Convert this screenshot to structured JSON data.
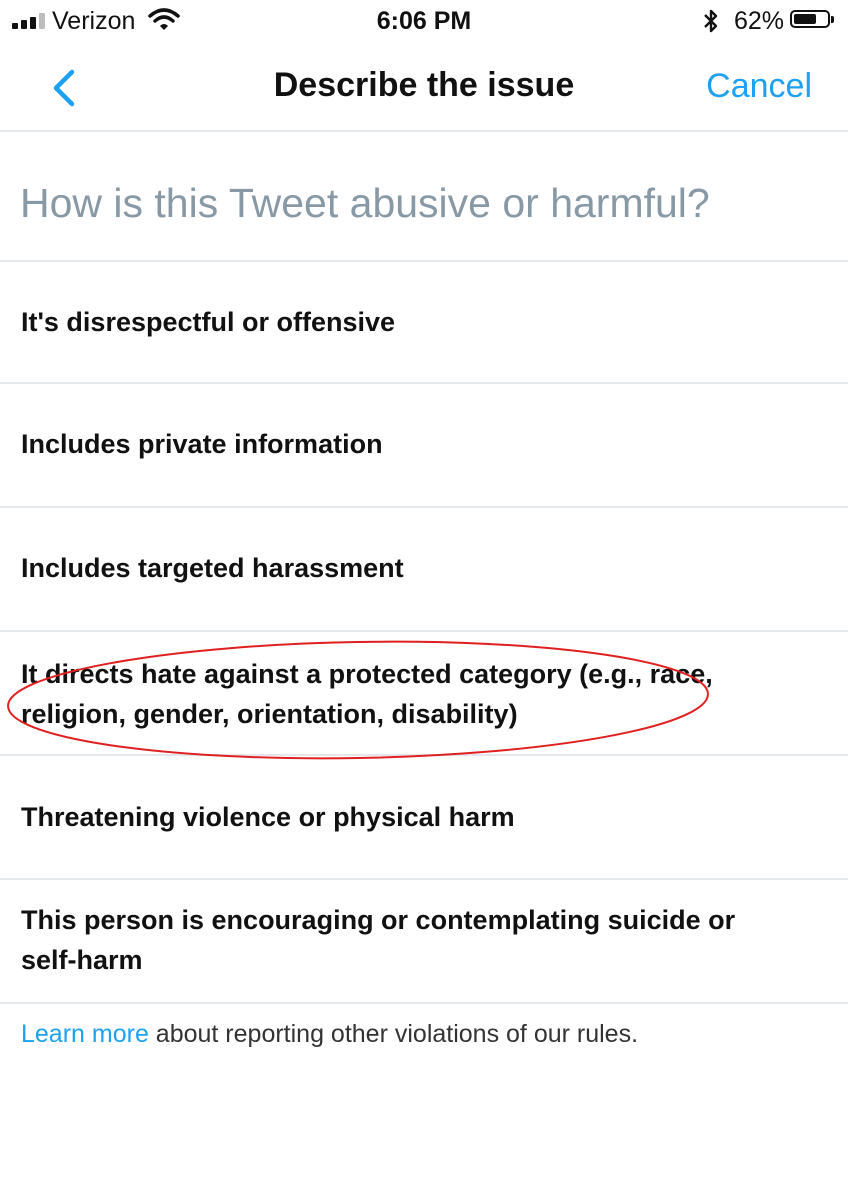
{
  "status_bar": {
    "carrier": "Verizon",
    "time": "6:06 PM",
    "battery_percent": "62%",
    "signal_icon": "signal-bars-icon",
    "wifi_icon": "wifi-icon",
    "bluetooth_icon": "bluetooth-icon",
    "battery_icon": "battery-icon"
  },
  "nav": {
    "title": "Describe the issue",
    "cancel_label": "Cancel",
    "back_icon": "chevron-left-icon"
  },
  "question": {
    "text": "How is this Tweet abusive or harmful?"
  },
  "options": [
    {
      "label": "It's disrespectful or offensive"
    },
    {
      "label": "Includes private information"
    },
    {
      "label": "Includes targeted harassment"
    },
    {
      "label": "It directs hate against a protected category (e.g., race, religion, gender, orientation, disability)"
    },
    {
      "label": "Threatening violence or physical harm"
    },
    {
      "label": "This person is encouraging or contemplating suicide or self-harm"
    }
  ],
  "footer": {
    "link_text": "Learn more",
    "text": " about reporting other violations of our rules."
  },
  "colors": {
    "accent": "#1da1f2",
    "question_text": "#8899a6",
    "divider": "#e4e8ec",
    "annotation": "#e02020"
  }
}
